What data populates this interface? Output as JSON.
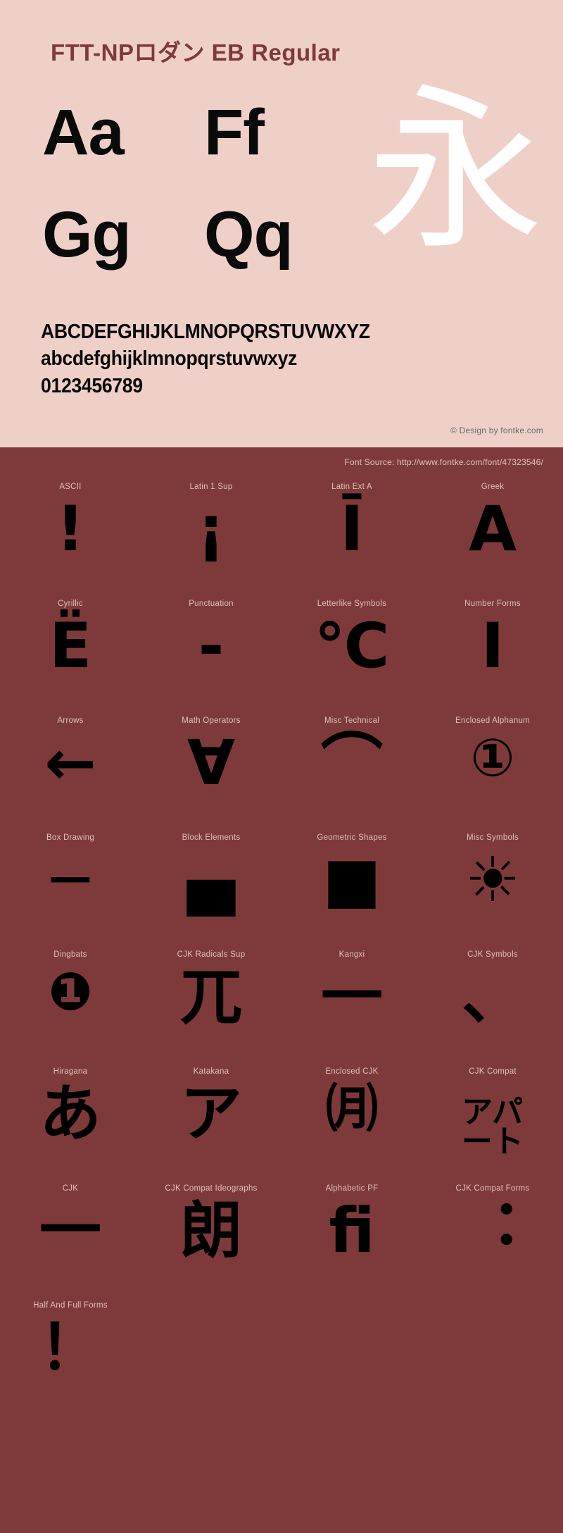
{
  "header": {
    "font_title": "FTT-NPロダン EB Regular"
  },
  "specimen": {
    "latin_pairs": [
      "Aa",
      "Ff",
      "Gg",
      "Qq"
    ],
    "cjk_glyph": "永",
    "alphabet_uppercase": "ABCDEFGHIJKLMNOPQRSTUVWXYZ",
    "alphabet_lowercase": "abcdefghijklmnopqrstuvwxyz",
    "digits": "0123456789",
    "copyright": "© Design by fontke.com"
  },
  "footer": {
    "font_source": "Font Source: http://www.fontke.com/font/47323546/"
  },
  "unicode_blocks": [
    {
      "label": "ASCII",
      "glyph": "!"
    },
    {
      "label": "Latin 1 Sup",
      "glyph": "¡"
    },
    {
      "label": "Latin Ext A",
      "glyph": "Ī"
    },
    {
      "label": "Greek",
      "glyph": "Α"
    },
    {
      "label": "Cyrillic",
      "glyph": "Ё"
    },
    {
      "label": "Punctuation",
      "glyph": "‐"
    },
    {
      "label": "Letterlike Symbols",
      "glyph": "℃"
    },
    {
      "label": "Number Forms",
      "glyph": "Ⅰ"
    },
    {
      "label": "Arrows",
      "glyph": "←"
    },
    {
      "label": "Math Operators",
      "glyph": "∀"
    },
    {
      "label": "Misc Technical",
      "glyph": "⌒"
    },
    {
      "label": "Enclosed Alphanum",
      "glyph": "①"
    },
    {
      "label": "Box Drawing",
      "glyph": "─"
    },
    {
      "label": "Block Elements",
      "glyph": "▄"
    },
    {
      "label": "Geometric Shapes",
      "glyph": "■"
    },
    {
      "label": "Misc Symbols",
      "glyph": "☀"
    },
    {
      "label": "Dingbats",
      "glyph": "❶"
    },
    {
      "label": "CJK Radicals Sup",
      "glyph": "兀"
    },
    {
      "label": "Kangxi",
      "glyph": "一"
    },
    {
      "label": "CJK Symbols",
      "glyph": "、"
    },
    {
      "label": "Hiragana",
      "glyph": "あ"
    },
    {
      "label": "Katakana",
      "glyph": "ア"
    },
    {
      "label": "Enclosed CJK",
      "glyph": "㈪"
    },
    {
      "label": "CJK Compat",
      "glyph": "アパート"
    },
    {
      "label": "CJK",
      "glyph": "一"
    },
    {
      "label": "CJK Compat Ideographs",
      "glyph": "朗"
    },
    {
      "label": "Alphabetic PF",
      "glyph": "ﬁ"
    },
    {
      "label": "CJK Compat Forms",
      "glyph": "︓"
    },
    {
      "label": "Half And Full Forms",
      "glyph": "！"
    }
  ],
  "colors": {
    "light_background": "#EFD0C9",
    "dark_background": "#7E3A3A",
    "title": "#7E3A3A",
    "glyph": "#000000",
    "cjk_sample": "#FFFFFF",
    "label": "#E0BFBA"
  }
}
